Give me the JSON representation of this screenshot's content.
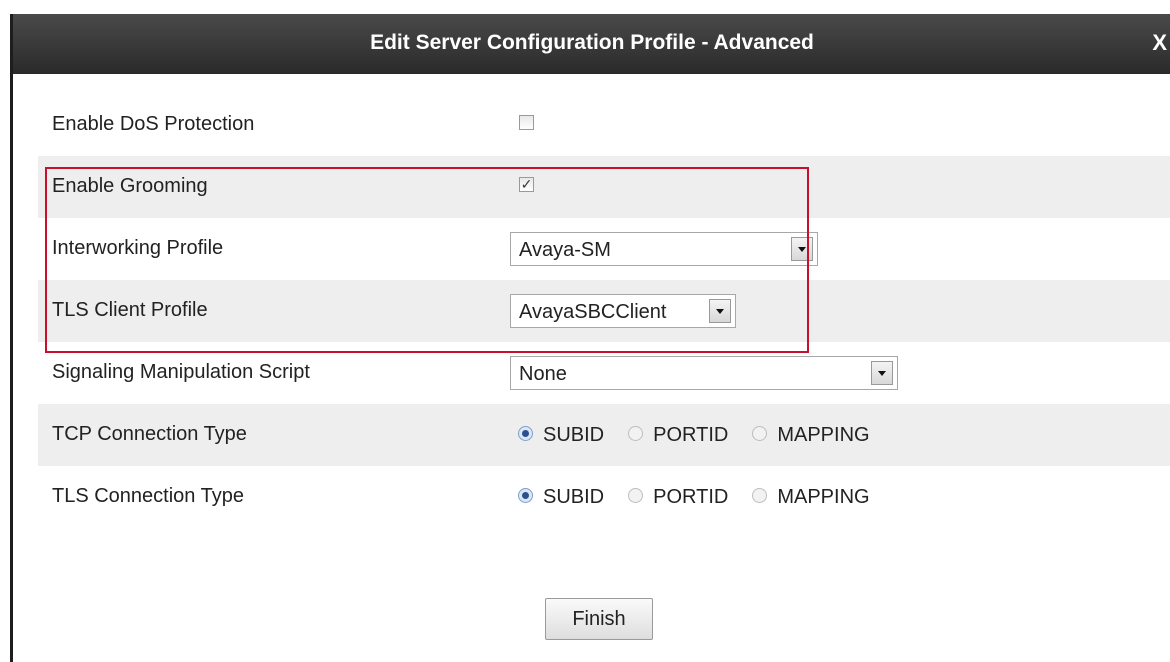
{
  "dialog": {
    "title": "Edit Server Configuration Profile - Advanced",
    "close_label": "X"
  },
  "rows": {
    "dos": {
      "label": "Enable DoS Protection",
      "checked": false
    },
    "grooming": {
      "label": "Enable Grooming",
      "checked": true,
      "check_glyph": "✓"
    },
    "interworking": {
      "label": "Interworking Profile",
      "value": "Avaya-SM"
    },
    "tls_client": {
      "label": "TLS Client Profile",
      "value": "AvayaSBCClient"
    },
    "script": {
      "label": "Signaling Manipulation Script",
      "value": "None"
    },
    "tcp": {
      "label": "TCP Connection Type",
      "options": [
        "SUBID",
        "PORTID",
        "MAPPING"
      ],
      "selected": "SUBID"
    },
    "tls": {
      "label": "TLS Connection Type",
      "options": [
        "SUBID",
        "PORTID",
        "MAPPING"
      ],
      "selected": "SUBID"
    }
  },
  "footer": {
    "finish_label": "Finish"
  },
  "colors": {
    "titlebar": "#333333",
    "highlight_border": "#c8102e",
    "row_shade": "#eeeeee"
  },
  "icons": {
    "close": "close-icon",
    "dropdown": "chevron-down-icon"
  }
}
